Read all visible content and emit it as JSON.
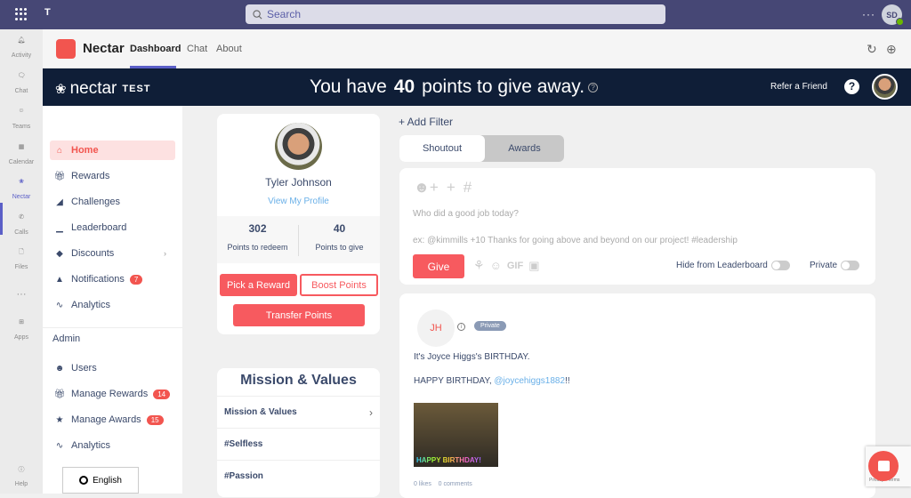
{
  "teams": {
    "search_placeholder": "Search",
    "more_label": "···",
    "user_initials": "SD",
    "rail": [
      {
        "label": "Activity",
        "icon": "bell-icon"
      },
      {
        "label": "Chat",
        "icon": "chat-icon"
      },
      {
        "label": "Teams",
        "icon": "teams-icon"
      },
      {
        "label": "Calendar",
        "icon": "calendar-icon"
      },
      {
        "label": "Nectar",
        "icon": "nectar-icon",
        "active": true
      },
      {
        "label": "Calls",
        "icon": "phone-icon"
      },
      {
        "label": "Files",
        "icon": "file-icon"
      },
      {
        "label": "···",
        "icon": "more-icon"
      },
      {
        "label": "Apps",
        "icon": "apps-icon"
      },
      {
        "label": "Help",
        "icon": "help-icon"
      }
    ]
  },
  "app": {
    "name": "Nectar",
    "tabs": [
      "Dashboard",
      "Chat",
      "About"
    ],
    "active_tab": "Dashboard"
  },
  "banner": {
    "logo_text": "nectar",
    "env_label": "TEST",
    "msg_prefix": "You have",
    "points": "40",
    "msg_suffix": "points to give away.",
    "refer_label": "Refer a Friend",
    "help_label": "?"
  },
  "sidebar": {
    "items": [
      {
        "label": "Home",
        "icon": "home-icon",
        "active": true
      },
      {
        "label": "Rewards",
        "icon": "gift-icon"
      },
      {
        "label": "Challenges",
        "icon": "flag-icon"
      },
      {
        "label": "Leaderboard",
        "icon": "podium-icon"
      },
      {
        "label": "Discounts",
        "icon": "tag-icon",
        "chevron": true
      },
      {
        "label": "Notifications",
        "icon": "bell-icon",
        "badge": "7"
      },
      {
        "label": "Analytics",
        "icon": "chart-icon"
      }
    ],
    "admin_label": "Admin",
    "admin_items": [
      {
        "label": "Users",
        "icon": "users-icon"
      },
      {
        "label": "Manage Rewards",
        "icon": "gift-icon",
        "badge": "14"
      },
      {
        "label": "Manage Awards",
        "icon": "trophy-icon",
        "badge": "15"
      },
      {
        "label": "Analytics",
        "icon": "chart-icon"
      }
    ],
    "language": "English"
  },
  "profile": {
    "name": "Tyler Johnson",
    "link": "View My Profile",
    "redeem_value": "302",
    "redeem_label": "Points to redeem",
    "give_value": "40",
    "give_label": "Points to give",
    "pick_reward": "Pick a Reward",
    "boost_points": "Boost Points",
    "transfer_points": "Transfer Points"
  },
  "mission": {
    "title": "Mission & Values",
    "rows": [
      "Mission & Values",
      "#Selfless",
      "#Passion"
    ]
  },
  "feed": {
    "add_filter": "+ Add Filter",
    "segments": [
      "Shoutout",
      "Awards"
    ],
    "compose_placeholder": "Who did a good job today?",
    "compose_example": "ex: @kimmills +10 Thanks for going above and beyond on our project! #leadership",
    "give_label": "Give",
    "gif_label": "GIF",
    "hide_leaderboard_label": "Hide from Leaderboard",
    "private_label": "Private",
    "hide_leaderboard_on": false,
    "private_on": false
  },
  "post": {
    "initials": "JH",
    "badge": "Private",
    "title": "It's Joyce Higgs's BIRTHDAY.",
    "body_prefix": "HAPPY BIRTHDAY, ",
    "mention": "@joycehiggs1882",
    "body_suffix": "!!",
    "gif_text": "HAPPY BIRTHDAY!",
    "likes": "0 likes",
    "comments": "0 comments"
  },
  "recaptcha": {
    "label": "Privacy - Terms"
  }
}
